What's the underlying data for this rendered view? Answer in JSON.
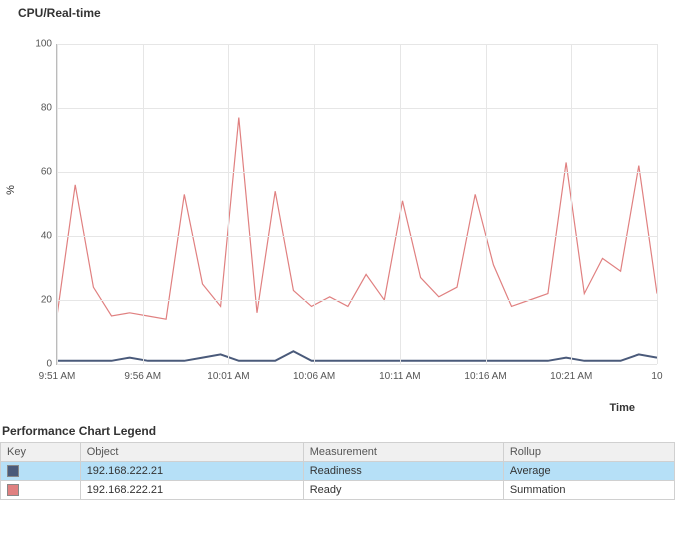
{
  "header": {
    "title": "CPU/Real-time"
  },
  "chart_data": {
    "type": "line",
    "ylabel": "%",
    "xlabel": "Time",
    "ylim": [
      0,
      100
    ],
    "yticks": [
      0,
      20,
      40,
      60,
      80,
      100
    ],
    "categories": [
      "9:51 AM",
      "",
      "",
      "",
      "",
      "9:56 AM",
      "",
      "",
      "",
      "",
      "10:01 AM",
      "",
      "",
      "",
      "",
      "10:06 AM",
      "",
      "",
      "",
      "",
      "10:11 AM",
      "",
      "",
      "",
      "",
      "10:16 AM",
      "",
      "",
      "",
      "",
      "10:21 AM",
      "",
      "",
      ""
    ],
    "xticks": [
      "9:51 AM",
      "9:56 AM",
      "10:01 AM",
      "10:06 AM",
      "10:11 AM",
      "10:16 AM",
      "10:21 AM",
      "10"
    ],
    "series": [
      {
        "name": "Readiness",
        "color": "#4a5a7a",
        "values": [
          1,
          1,
          1,
          1,
          2,
          1,
          1,
          1,
          2,
          3,
          1,
          1,
          1,
          4,
          1,
          1,
          1,
          1,
          1,
          1,
          1,
          1,
          1,
          1,
          1,
          1,
          1,
          1,
          2,
          1,
          1,
          1,
          3,
          2
        ]
      },
      {
        "name": "Ready",
        "color": "#e08080",
        "values": [
          15,
          56,
          24,
          15,
          16,
          15,
          14,
          53,
          25,
          18,
          77,
          16,
          54,
          23,
          18,
          21,
          18,
          28,
          20,
          51,
          27,
          21,
          24,
          53,
          31,
          18,
          20,
          22,
          63,
          22,
          33,
          29,
          62,
          22
        ]
      }
    ]
  },
  "legend": {
    "title": "Performance Chart Legend",
    "headers": {
      "key": "Key",
      "object": "Object",
      "measurement": "Measurement",
      "rollup": "Rollup"
    },
    "rows": [
      {
        "color": "#4a5a7a",
        "object": "192.168.222.21",
        "measurement": "Readiness",
        "rollup": "Average",
        "selected": true
      },
      {
        "color": "#e08080",
        "object": "192.168.222.21",
        "measurement": "Ready",
        "rollup": "Summation",
        "selected": false
      }
    ]
  }
}
